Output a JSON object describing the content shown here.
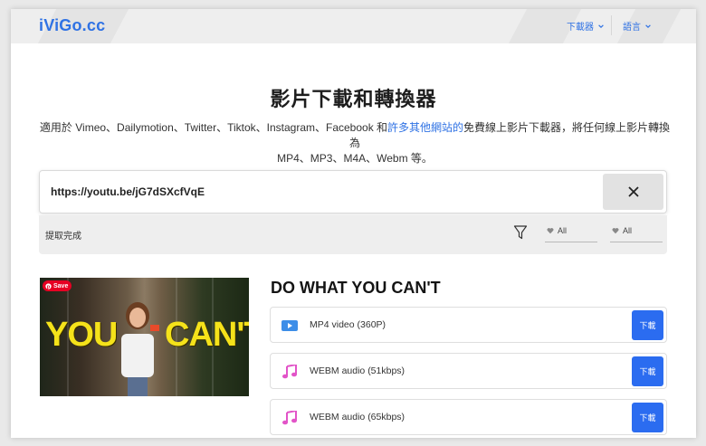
{
  "header": {
    "logo": "iViGo.cc",
    "nav": [
      {
        "label": "下載器"
      },
      {
        "label": "語言"
      }
    ]
  },
  "hero": {
    "title": "影片下載和轉換器",
    "desc_part1": "適用於 Vimeo、Dailymotion、Twitter、Tiktok、Instagram、Facebook 和",
    "desc_link": "許多其他網站的",
    "desc_part2": "免費線上影片下載器，將任何線上影片轉換為",
    "desc_line2": "MP4、MP3、M4A、Webm 等。"
  },
  "search": {
    "url": "https://youtu.be/jG7dSXcfVqE",
    "placeholder": ""
  },
  "toolbar": {
    "status": "提取完成",
    "filter1": "All",
    "filter2": "All"
  },
  "video": {
    "title": "DO WHAT YOU CAN'T",
    "thumb_text_left": "YOU",
    "thumb_text_right": "CAN'T",
    "save_label": "Save",
    "formats": [
      {
        "label": "MP4 video (360P)",
        "icon": "video-icon",
        "button": "下載"
      },
      {
        "label": "WEBM audio (51kbps)",
        "icon": "music-note-icon",
        "button": "下載"
      },
      {
        "label": "WEBM audio (65kbps)",
        "icon": "music-note-icon",
        "button": "下載"
      }
    ]
  },
  "colors": {
    "accent": "#2f72e4",
    "button": "#2b6cf0",
    "thumb_text": "#f5e21a",
    "pinterest": "#e60023"
  }
}
